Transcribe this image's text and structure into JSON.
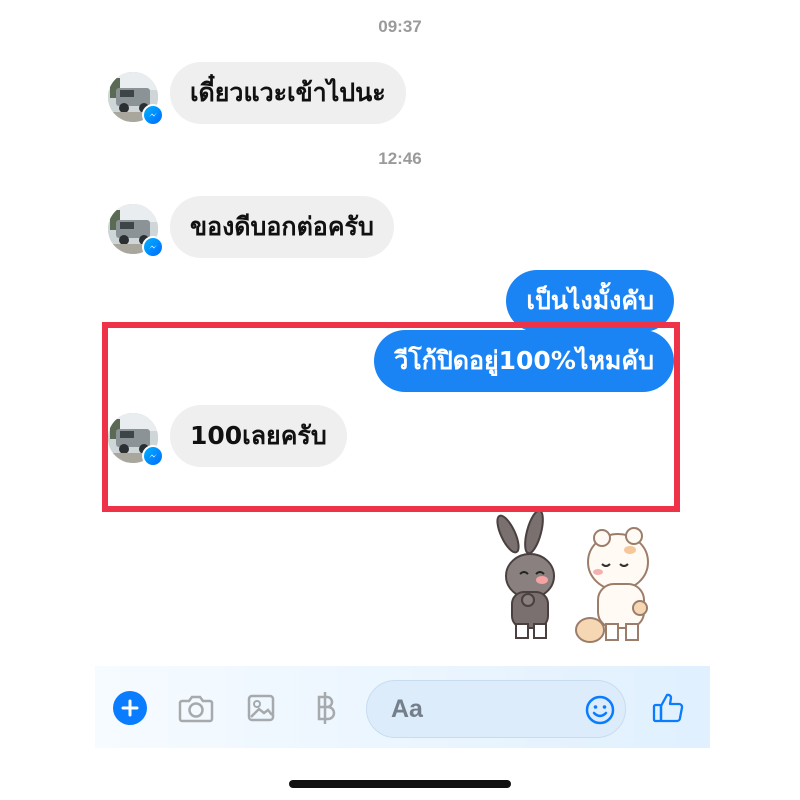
{
  "timestamps": [
    "09:37",
    "12:46"
  ],
  "messages": [
    {
      "text": "เดี๋ยวแวะเข้าไปนะ",
      "side": "incoming"
    },
    {
      "text": "ของดีบอกต่อครับ",
      "side": "incoming"
    },
    {
      "text": "เป็นไงมั้งคับ",
      "side": "outgoing"
    },
    {
      "text": "วีโก้ปิดอยู่100%ไหมคับ",
      "side": "outgoing"
    },
    {
      "text": "100เลยครับ",
      "side": "incoming"
    }
  ],
  "composer": {
    "placeholder": "Aa",
    "icons": [
      "plus-icon",
      "camera-icon",
      "image-icon",
      "baht-icon",
      "emoji-icon",
      "thumbs-up-icon"
    ]
  },
  "colors": {
    "outgoing_bubble": "#1b84f5",
    "incoming_bubble": "#efefef",
    "highlight_border": "#ee3248",
    "accent": "#0a84ff"
  }
}
